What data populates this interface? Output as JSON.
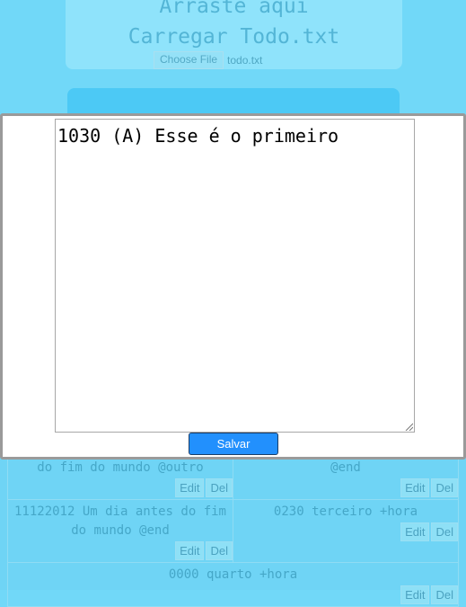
{
  "upload": {
    "drop_hint": "Arraste aqui",
    "load_label": "Carregar Todo.txt",
    "choose_file_label": "Choose File",
    "file_name": "todo.txt"
  },
  "modal": {
    "editor_text": "1030 (A) Esse é o primeiro",
    "save_label": "Salvar"
  },
  "tasks": [
    {
      "text": "do fim do mundo @outro",
      "edit": "Edit",
      "del": "Del"
    },
    {
      "text": "@end",
      "edit": "Edit",
      "del": "Del"
    },
    {
      "text": "11122012 Um dia antes do fim do mundo @end",
      "edit": "Edit",
      "del": "Del"
    },
    {
      "text": "0230 terceiro +hora",
      "edit": "Edit",
      "del": "Del"
    },
    {
      "text": "0000 quarto +hora",
      "edit": "Edit",
      "del": "Del"
    }
  ],
  "colors": {
    "page_bg": "#71d8f8",
    "save_button": "#2290fd"
  }
}
